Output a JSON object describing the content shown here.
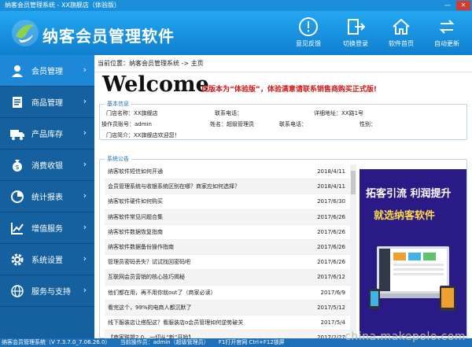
{
  "window": {
    "title": "纳客会员管理系统 - XX旗舰店（体验版）"
  },
  "header": {
    "brand": "纳客会员管理软件",
    "toolbar": [
      {
        "label": "意见反馈",
        "icon": "exclamation-icon"
      },
      {
        "label": "切换登录",
        "icon": "switch-login-icon"
      },
      {
        "label": "软件首页",
        "icon": "home-icon"
      },
      {
        "label": "自动更新",
        "icon": "refresh-icon"
      }
    ]
  },
  "sidebar": {
    "items": [
      {
        "label": "会员管理",
        "icon": "user-icon",
        "active": true
      },
      {
        "label": "商品管理",
        "icon": "document-icon",
        "active": false
      },
      {
        "label": "产品库存",
        "icon": "truck-icon",
        "active": false
      },
      {
        "label": "消费收银",
        "icon": "money-bag-icon",
        "active": false
      },
      {
        "label": "统计报表",
        "icon": "pie-chart-icon",
        "active": false
      },
      {
        "label": "增值服务",
        "icon": "line-chart-icon",
        "active": false
      },
      {
        "label": "系统设置",
        "icon": "gear-icon",
        "active": false
      },
      {
        "label": "服务与支持",
        "icon": "globe-icon",
        "active": false
      }
    ]
  },
  "main": {
    "breadcrumb": "当前位置：纳客会员管理系统 -> 主页",
    "welcome": "Welcome",
    "notice": "此版本为“体验版”，体验满意请联系销售商购买正式版!",
    "basic": {
      "legend": "基本信息",
      "store_name_label": "门店名称：",
      "store_name": "XX旗舰店",
      "phone_label": "联系电话：",
      "address_label": "详细地址：",
      "address": "XX路1号",
      "operator_account_label": "操作员账号：",
      "operator_account": "admin",
      "name_label": "姓名：",
      "name": "超级管理员",
      "phone2_label": "联系电话：",
      "gender_label": "性别：",
      "intro_label": "门店简介：",
      "intro": "XX旗舰店欢迎您！"
    },
    "announcements": {
      "legend": "系统公告",
      "items": [
        {
          "title": "纳客软件短信如何开通",
          "date": "2018/4/11"
        },
        {
          "title": "会员管理系统与收银系统区别在哪？商家应如何选择？",
          "date": "2018/4/11"
        },
        {
          "title": "纳客软件硬件如何购买",
          "date": "2017/6/30"
        },
        {
          "title": "纳客软件常见问题合集",
          "date": "2017/6/26"
        },
        {
          "title": "纳客软件数据恢复指南",
          "date": "2017/6/26"
        },
        {
          "title": "纳客软件数据备份操作指南",
          "date": "2017/6/26"
        },
        {
          "title": "管理员密码丢失？试试找回密码吧",
          "date": "2017/6/26"
        },
        {
          "title": "互联网会员营销的核心技巧揭秘",
          "date": "2017/6/12"
        },
        {
          "title": "他们都在用，再不用你就out了（商家必读）",
          "date": "2017/6/9"
        },
        {
          "title": "看完这个，99%的电商人都沉默了",
          "date": "2017/5/12"
        },
        {
          "title": "线下服装店让搭配这？看服装店o会员管理如何逆势破关",
          "date": "2017/5/4"
        },
        {
          "title": "【商家联盟2.0，一切从“新”开始】",
          "date": "2017/2/27"
        }
      ]
    },
    "ad": {
      "line1": "拓客引流 利润提升",
      "line2": "就选纳客软件"
    }
  },
  "status": {
    "version": "纳客会员管理系统（V 7.3.7.0_7.06.26.0）",
    "operator": "当前操作员：admin（超级管理员）",
    "shortcuts": "F1打开官网 Ctrl+F12锁屏"
  },
  "watermark": "china.makepolo.com",
  "colors": {
    "header": "#1b8ed9",
    "sidebar": "#15609e",
    "sidebar_active": "#1e88d8",
    "notice": "#d01818"
  }
}
